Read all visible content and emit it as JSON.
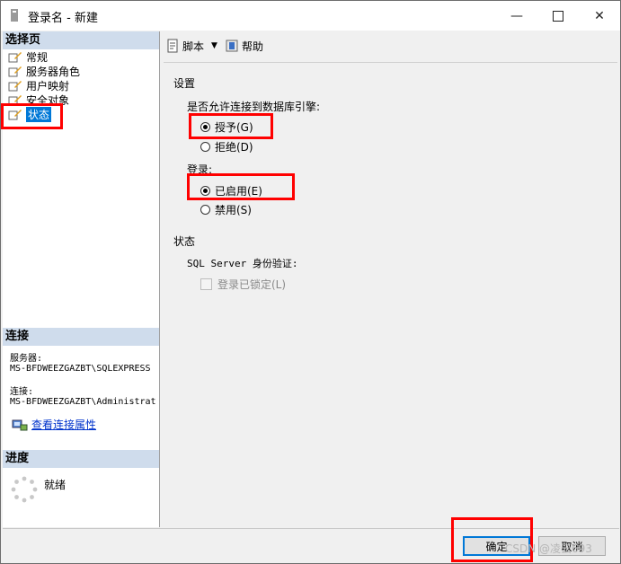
{
  "window": {
    "title": "登录名 - 新建"
  },
  "left": {
    "select_page_header": "选择页",
    "pages": [
      {
        "label": "常规"
      },
      {
        "label": "服务器角色"
      },
      {
        "label": "用户映射"
      },
      {
        "label": "安全对象"
      },
      {
        "label": "状态"
      }
    ],
    "connection_header": "连接",
    "server_label": "服务器:",
    "server_value": "MS-BFDWEEZGAZBT\\SQLEXPRESS",
    "connection_label": "连接:",
    "connection_value": "MS-BFDWEEZGAZBT\\Administrat",
    "view_connection_link": "查看连接属性",
    "progress_header": "进度",
    "progress_status": "就绪"
  },
  "toolbar": {
    "script_label": "脚本",
    "help_label": "帮助"
  },
  "settings": {
    "header": "设置",
    "db_engine_question": "是否允许连接到数据库引擎:",
    "grant_label": "授予(G)",
    "deny_label": "拒绝(D)",
    "login_label": "登录:",
    "enabled_label": "已启用(E)",
    "disabled_label": "禁用(S)"
  },
  "status": {
    "header": "状态",
    "auth_label": "SQL Server 身份验证:",
    "locked_label": "登录已锁定(L)"
  },
  "buttons": {
    "ok_label": "确定",
    "cancel_label": "取消"
  },
  "watermark": "CSDN @凌云693"
}
